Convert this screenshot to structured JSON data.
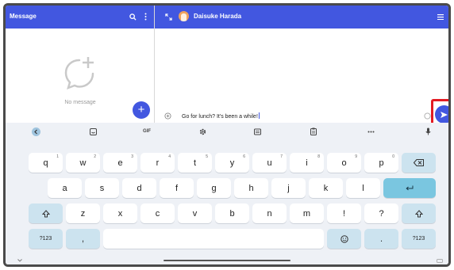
{
  "left_panel": {
    "title": "Message",
    "empty_text": "No message"
  },
  "conversation": {
    "contact_name": "Daisuke Harada",
    "draft_text": "Go for lunch? It's been a while!"
  },
  "keyboard": {
    "toolbar": {
      "gif_label": "GIF"
    },
    "rows": [
      [
        {
          "label": "q",
          "hint": "1"
        },
        {
          "label": "w",
          "hint": "2"
        },
        {
          "label": "e",
          "hint": "3"
        },
        {
          "label": "r",
          "hint": "4"
        },
        {
          "label": "t",
          "hint": "5"
        },
        {
          "label": "y",
          "hint": "6"
        },
        {
          "label": "u",
          "hint": "7"
        },
        {
          "label": "i",
          "hint": "8"
        },
        {
          "label": "o",
          "hint": "9"
        },
        {
          "label": "p",
          "hint": "0"
        }
      ],
      [
        {
          "label": "a"
        },
        {
          "label": "s"
        },
        {
          "label": "d"
        },
        {
          "label": "f"
        },
        {
          "label": "g"
        },
        {
          "label": "h"
        },
        {
          "label": "j"
        },
        {
          "label": "k"
        },
        {
          "label": "l"
        }
      ],
      [
        {
          "label": "z"
        },
        {
          "label": "x"
        },
        {
          "label": "c"
        },
        {
          "label": "v"
        },
        {
          "label": "b"
        },
        {
          "label": "n"
        },
        {
          "label": "m"
        },
        {
          "label": "!"
        },
        {
          "label": "?"
        }
      ]
    ],
    "symbols_label": "?123",
    "comma_label": ",",
    "period_label": "."
  },
  "colors": {
    "header": "#4257e0",
    "send_highlight": "#e31b23",
    "keyboard_bg": "#eef1f6",
    "enter_key": "#7ac6e0"
  }
}
